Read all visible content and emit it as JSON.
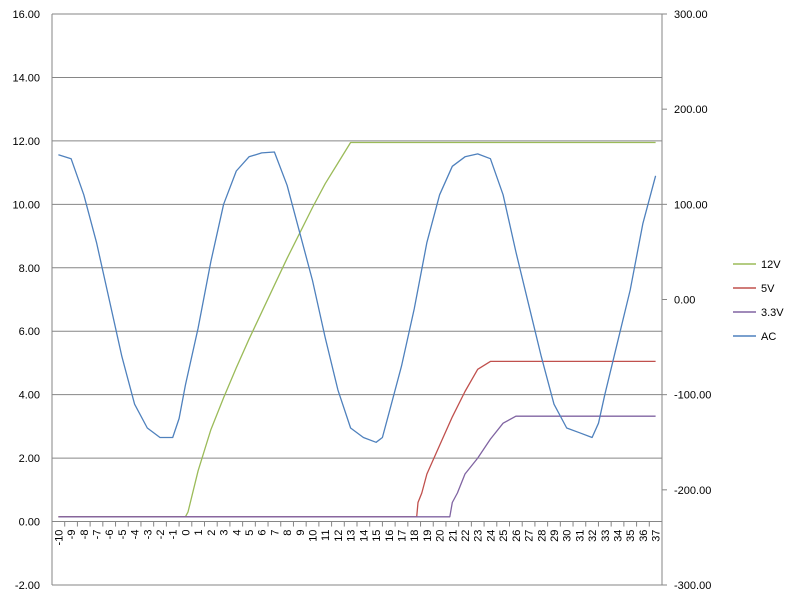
{
  "chart_data": {
    "type": "line",
    "title": "",
    "xlabel": "",
    "ylabel": "",
    "y_left": {
      "lim": [
        -2,
        16
      ],
      "ticks": [
        "-2.00",
        "0.00",
        "2.00",
        "4.00",
        "6.00",
        "8.00",
        "10.00",
        "12.00",
        "14.00",
        "16.00"
      ]
    },
    "y_right": {
      "lim": [
        -300,
        300
      ],
      "ticks": [
        "-300.00",
        "-200.00",
        "-100.00",
        "0.00",
        "100.00",
        "200.00",
        "300.00"
      ]
    },
    "x": {
      "lim": [
        -10,
        37
      ],
      "tick_labels": [
        "-10",
        "-9",
        "-8",
        "-7",
        "-6",
        "-5",
        "-4",
        "-3",
        "-2",
        "-1",
        "0",
        "1",
        "2",
        "3",
        "4",
        "5",
        "6",
        "7",
        "8",
        "9",
        "10",
        "11",
        "12",
        "13",
        "14",
        "15",
        "16",
        "17",
        "18",
        "19",
        "20",
        "21",
        "22",
        "23",
        "24",
        "25",
        "26",
        "27",
        "28",
        "29",
        "30",
        "31",
        "32",
        "33",
        "34",
        "35",
        "36",
        "37"
      ]
    },
    "grid": true,
    "legend_position": "right",
    "series": [
      {
        "name": "12V",
        "axis": "left",
        "color": "#9bbb59",
        "points": [
          [
            -10,
            0.15
          ],
          [
            0,
            0.15
          ],
          [
            0.2,
            0.3
          ],
          [
            1,
            1.6
          ],
          [
            2,
            2.9
          ],
          [
            3,
            3.9
          ],
          [
            4,
            4.85
          ],
          [
            5,
            5.75
          ],
          [
            6,
            6.6
          ],
          [
            7,
            7.45
          ],
          [
            8,
            8.3
          ],
          [
            9,
            9.1
          ],
          [
            10,
            9.9
          ],
          [
            11,
            10.65
          ],
          [
            12,
            11.3
          ],
          [
            13,
            11.95
          ],
          [
            14,
            11.95
          ],
          [
            37,
            11.95
          ]
        ]
      },
      {
        "name": "5V",
        "axis": "left",
        "color": "#c0504d",
        "points": [
          [
            -10,
            0.15
          ],
          [
            18.2,
            0.15
          ],
          [
            18.3,
            0.6
          ],
          [
            18.6,
            0.9
          ],
          [
            19,
            1.5
          ],
          [
            20,
            2.4
          ],
          [
            21,
            3.3
          ],
          [
            22,
            4.1
          ],
          [
            23,
            4.8
          ],
          [
            24,
            5.05
          ],
          [
            37,
            5.05
          ]
        ]
      },
      {
        "name": "3.3V",
        "axis": "left",
        "color": "#8064a2",
        "points": [
          [
            -10,
            0.15
          ],
          [
            20.8,
            0.15
          ],
          [
            21,
            0.6
          ],
          [
            21.4,
            0.9
          ],
          [
            22,
            1.5
          ],
          [
            23,
            2.0
          ],
          [
            24,
            2.6
          ],
          [
            25,
            3.1
          ],
          [
            26,
            3.32
          ],
          [
            37,
            3.32
          ]
        ]
      },
      {
        "name": "AC",
        "axis": "right",
        "color": "#4f81bd",
        "points": [
          [
            -10,
            152
          ],
          [
            -9,
            148
          ],
          [
            -8,
            110
          ],
          [
            -7,
            60
          ],
          [
            -6,
            0
          ],
          [
            -5,
            -60
          ],
          [
            -4,
            -110
          ],
          [
            -3,
            -135
          ],
          [
            -2,
            -145
          ],
          [
            -1,
            -145
          ],
          [
            -0.5,
            -125
          ],
          [
            0,
            -90
          ],
          [
            1,
            -30
          ],
          [
            2,
            40
          ],
          [
            3,
            100
          ],
          [
            4,
            135
          ],
          [
            5,
            150
          ],
          [
            6,
            154
          ],
          [
            7,
            155
          ],
          [
            8,
            120
          ],
          [
            9,
            70
          ],
          [
            10,
            20
          ],
          [
            11,
            -40
          ],
          [
            12,
            -95
          ],
          [
            13,
            -135
          ],
          [
            14,
            -145
          ],
          [
            15,
            -150
          ],
          [
            15.5,
            -145
          ],
          [
            16,
            -120
          ],
          [
            17,
            -70
          ],
          [
            18,
            -10
          ],
          [
            19,
            60
          ],
          [
            20,
            110
          ],
          [
            21,
            140
          ],
          [
            22,
            150
          ],
          [
            23,
            153
          ],
          [
            24,
            148
          ],
          [
            25,
            110
          ],
          [
            26,
            50
          ],
          [
            27,
            -5
          ],
          [
            28,
            -60
          ],
          [
            29,
            -110
          ],
          [
            30,
            -135
          ],
          [
            31,
            -140
          ],
          [
            32,
            -145
          ],
          [
            32.5,
            -130
          ],
          [
            33,
            -100
          ],
          [
            34,
            -45
          ],
          [
            35,
            10
          ],
          [
            36,
            80
          ],
          [
            37,
            130
          ]
        ]
      }
    ]
  }
}
